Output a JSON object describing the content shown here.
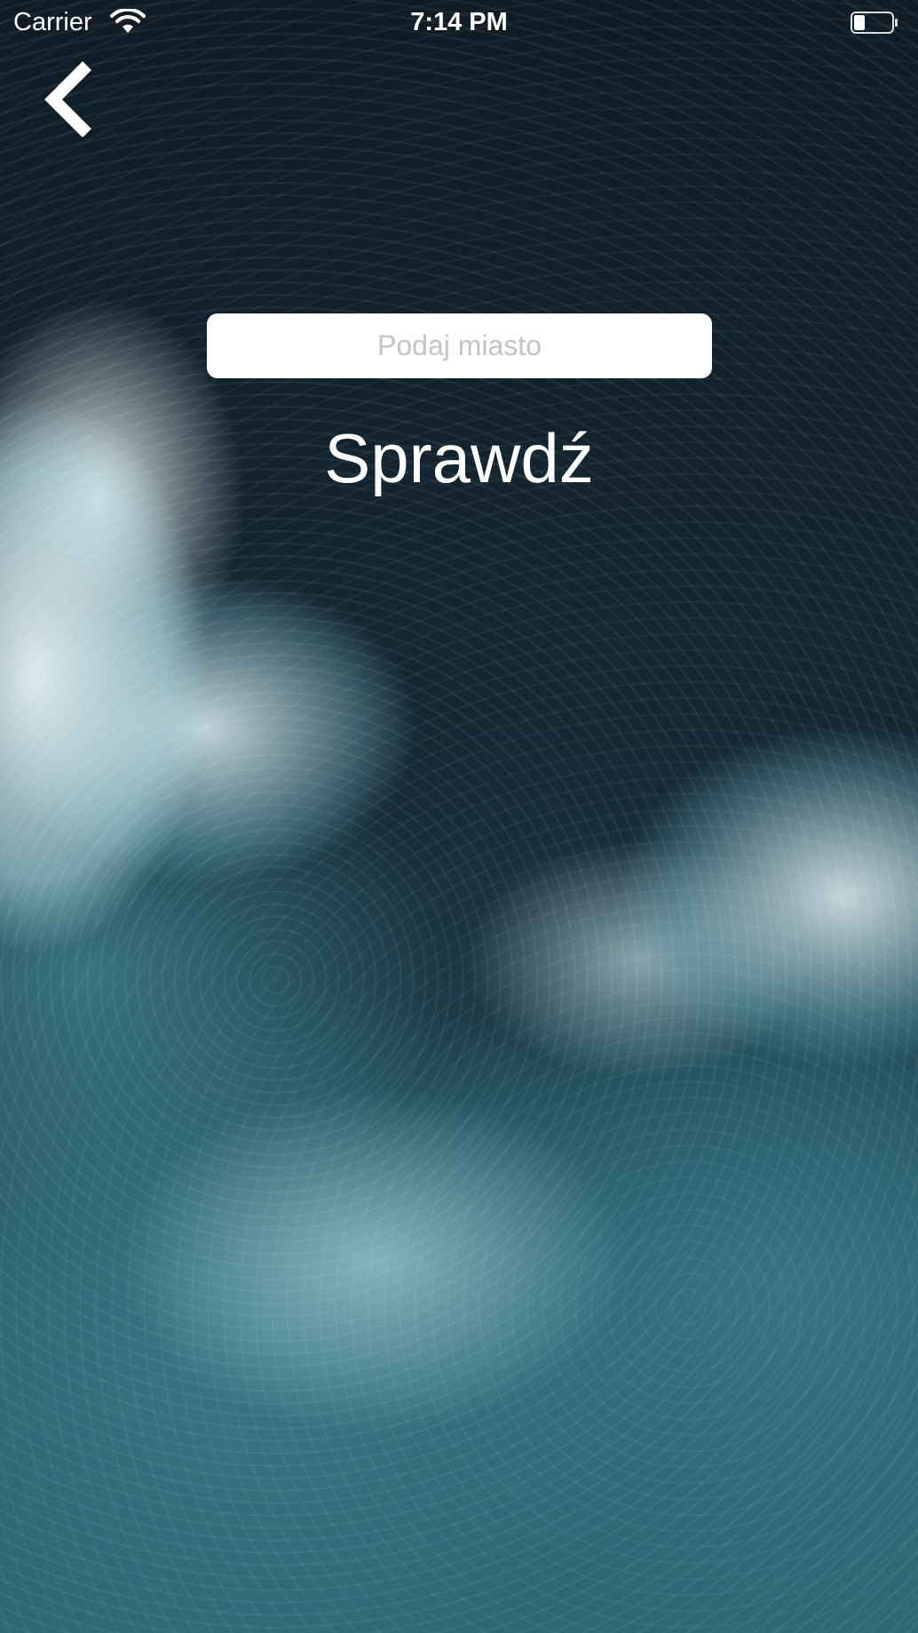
{
  "status_bar": {
    "carrier": "Carrier",
    "time": "7:14 PM",
    "wifi_icon": "wifi-icon",
    "battery_icon": "battery-icon"
  },
  "navigation": {
    "back_icon": "chevron-left-icon"
  },
  "search": {
    "placeholder": "Podaj miasto",
    "value": ""
  },
  "actions": {
    "check_label": "Sprawdź"
  },
  "colors": {
    "text": "#ffffff",
    "input_background": "#ffffff",
    "placeholder": "#c4c4c8",
    "ocean_dark": "#13232e",
    "ocean_teal": "#2f6776"
  }
}
